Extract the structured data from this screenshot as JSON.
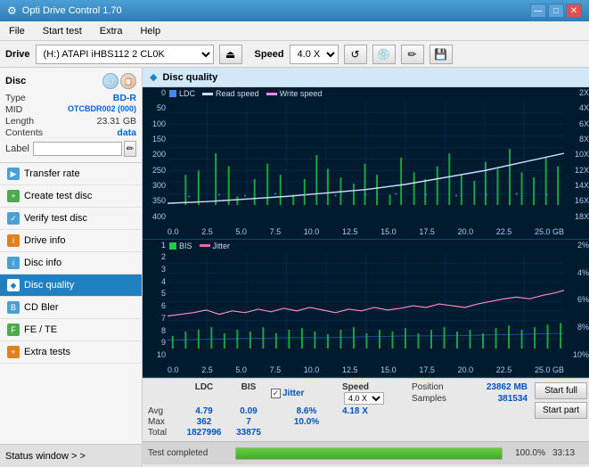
{
  "app": {
    "title": "Opti Drive Control 1.70",
    "title_icon": "⚙"
  },
  "title_bar": {
    "minimize": "—",
    "maximize": "□",
    "close": "✕"
  },
  "menu": {
    "items": [
      "File",
      "Start test",
      "Extra",
      "Help"
    ]
  },
  "toolbar": {
    "drive_label": "Drive",
    "drive_value": "(H:) ATAPI iHBS112  2 CL0K",
    "eject_icon": "⏏",
    "speed_label": "Speed",
    "speed_value": "4.0 X",
    "icon1": "🔄",
    "icon2": "💿",
    "icon3": "🖊",
    "icon4": "💾"
  },
  "disc": {
    "title": "Disc",
    "type_label": "Type",
    "type_value": "BD-R",
    "mid_label": "MID",
    "mid_value": "OTCBDR002 (000)",
    "length_label": "Length",
    "length_value": "23.31 GB",
    "contents_label": "Contents",
    "contents_value": "data",
    "label_label": "Label",
    "label_value": ""
  },
  "nav": {
    "items": [
      {
        "id": "transfer-rate",
        "label": "Transfer rate",
        "icon": "▶"
      },
      {
        "id": "create-test-disc",
        "label": "Create test disc",
        "icon": "+"
      },
      {
        "id": "verify-test-disc",
        "label": "Verify test disc",
        "icon": "✓"
      },
      {
        "id": "drive-info",
        "label": "Drive info",
        "icon": "i"
      },
      {
        "id": "disc-info",
        "label": "Disc info",
        "icon": "i"
      },
      {
        "id": "disc-quality",
        "label": "Disc quality",
        "icon": "◆",
        "active": true
      },
      {
        "id": "cd-bler",
        "label": "CD Bler",
        "icon": "B"
      },
      {
        "id": "fe-te",
        "label": "FE / TE",
        "icon": "F"
      },
      {
        "id": "extra-tests",
        "label": "Extra tests",
        "icon": "+"
      }
    ]
  },
  "status_window": {
    "label": "Status window > >"
  },
  "quality": {
    "title": "Disc quality",
    "icon": "◆",
    "legend": {
      "ldc_label": "LDC",
      "read_label": "Read speed",
      "write_label": "Write speed",
      "bis_label": "BIS",
      "jitter_label": "Jitter"
    }
  },
  "chart1": {
    "y_left": [
      "400",
      "350",
      "300",
      "250",
      "200",
      "150",
      "100",
      "50",
      "0"
    ],
    "y_right": [
      "18X",
      "16X",
      "14X",
      "12X",
      "10X",
      "8X",
      "6X",
      "4X",
      "2X"
    ],
    "x_labels": [
      "0.0",
      "2.5",
      "5.0",
      "7.5",
      "10.0",
      "12.5",
      "15.0",
      "17.5",
      "20.0",
      "22.5",
      "25.0 GB"
    ]
  },
  "chart2": {
    "y_left": [
      "10",
      "9",
      "8",
      "7",
      "6",
      "5",
      "4",
      "3",
      "2",
      "1"
    ],
    "y_right": [
      "10%",
      "8%",
      "6%",
      "4%",
      "2%"
    ],
    "x_labels": [
      "0.0",
      "2.5",
      "5.0",
      "7.5",
      "10.0",
      "12.5",
      "15.0",
      "17.5",
      "20.0",
      "22.5",
      "25.0 GB"
    ]
  },
  "stats": {
    "headers": [
      "",
      "LDC",
      "BIS",
      "",
      "Jitter",
      "Speed"
    ],
    "avg_label": "Avg",
    "avg_ldc": "4.79",
    "avg_bis": "0.09",
    "avg_jitter": "8.6%",
    "avg_speed": "4.18 X",
    "max_label": "Max",
    "max_ldc": "362",
    "max_bis": "7",
    "max_jitter": "10.0%",
    "total_label": "Total",
    "total_ldc": "1827996",
    "total_bis": "33875",
    "speed_select": "4.0 X",
    "jitter_checked": true,
    "position_label": "Position",
    "position_value": "23862 MB",
    "samples_label": "Samples",
    "samples_value": "381534",
    "btn_start_full": "Start full",
    "btn_start_part": "Start part"
  },
  "progress": {
    "status": "Test completed",
    "percent": "100.0%",
    "fill_width": 100,
    "time": "33:13"
  },
  "colors": {
    "accent_blue": "#2080c0",
    "ldc_color": "#4488ff",
    "bis_color": "#00cc44",
    "jitter_color": "#ff66aa",
    "read_speed_color": "#ffffff",
    "grid_color": "#003366"
  }
}
